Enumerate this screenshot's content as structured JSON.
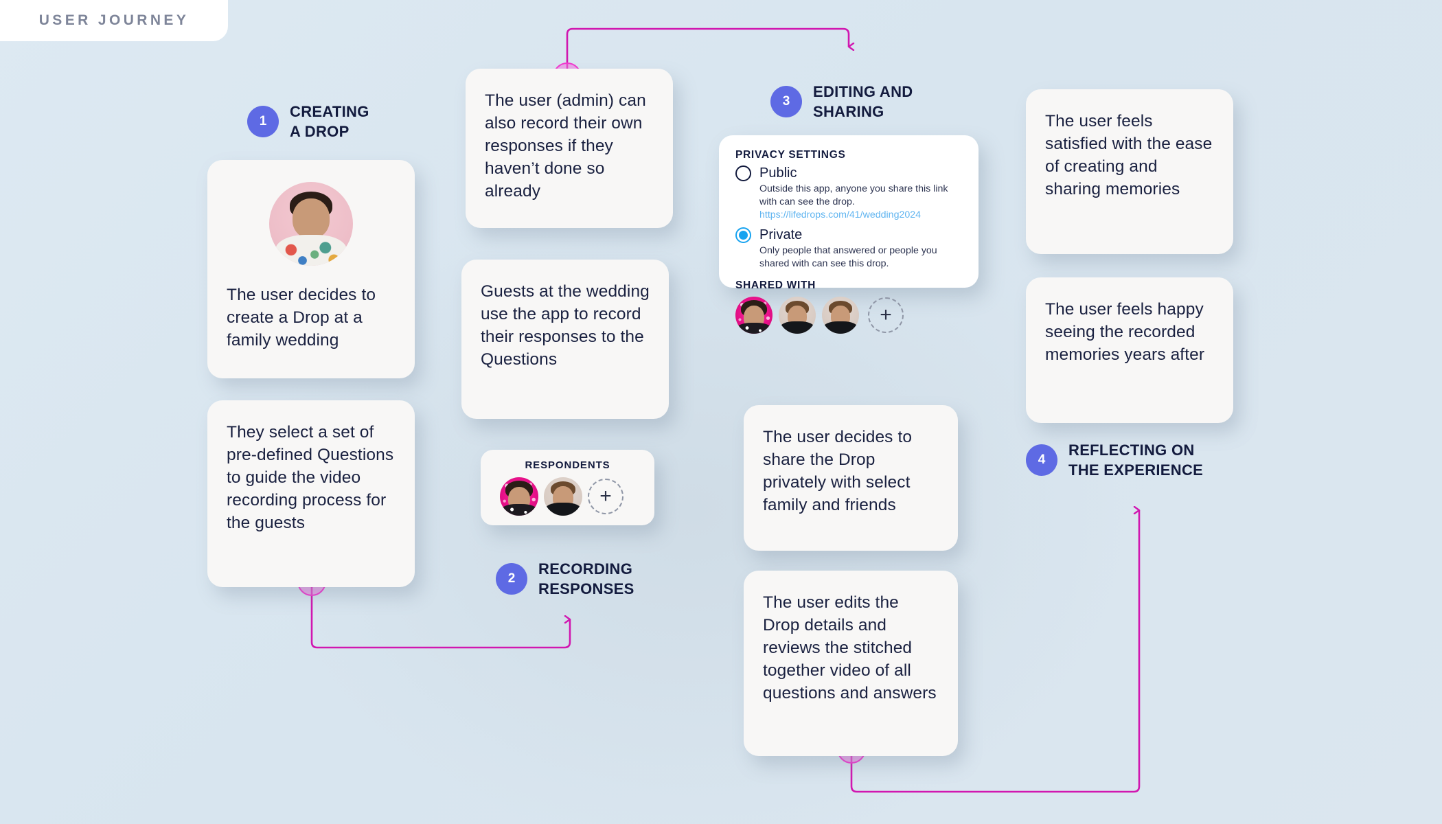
{
  "header": {
    "tab_label": "USER JOURNEY"
  },
  "theme": {
    "background": "#dbe7f0",
    "card_bg": "#f8f7f6",
    "text": "#1a2140",
    "step_badge": "#5e6ae4",
    "connector": "#d117b0",
    "accent_blue": "#17a3f0",
    "link": "#5fb4f0"
  },
  "steps": [
    {
      "number": "1",
      "label": "CREATING\nA DROP"
    },
    {
      "number": "2",
      "label": "RECORDING\nRESPONSES"
    },
    {
      "number": "3",
      "label": "EDITING AND\nSHARING"
    },
    {
      "number": "4",
      "label": "REFLECTING ON\nTHE EXPERIENCE"
    }
  ],
  "cards": {
    "create_drop": "The user decides to create a Drop at a family wedding",
    "predefined_questions": "They select a set of pre-defined Questions to guide the video recording process for the guests",
    "admin_record": "The user (admin) can also record their own responses if they haven’t done so already",
    "guests_record": "Guests at the wedding use the app to record their responses to the Questions",
    "share_privately": "The user decides to share the Drop privately with select family and friends",
    "edit_review": "The user edits the Drop details and reviews the stitched together video of all questions and answers",
    "feels_satisfied": "The user feels satisfied with the ease of creating and sharing memories",
    "feels_happy": "The user feels happy seeing the recorded memories years after"
  },
  "respondents_widget": {
    "heading": "RESPONDENTS",
    "avatars": [
      "respondent-avatar-1",
      "respondent-avatar-2"
    ],
    "add_label": "+"
  },
  "privacy_card": {
    "heading": "PRIVACY SETTINGS",
    "options": [
      {
        "name": "Public",
        "selected": false,
        "description": "Outside this app, anyone you share this link with can see the drop.",
        "link": "https://lifedrops.com/41/wedding2024"
      },
      {
        "name": "Private",
        "selected": true,
        "description": "Only people that answered or people you shared with can see this drop.",
        "link": ""
      }
    ],
    "shared_with_heading": "SHARED WITH",
    "shared_avatars": [
      "shared-avatar-1",
      "shared-avatar-2",
      "shared-avatar-3"
    ],
    "add_label": "+"
  }
}
